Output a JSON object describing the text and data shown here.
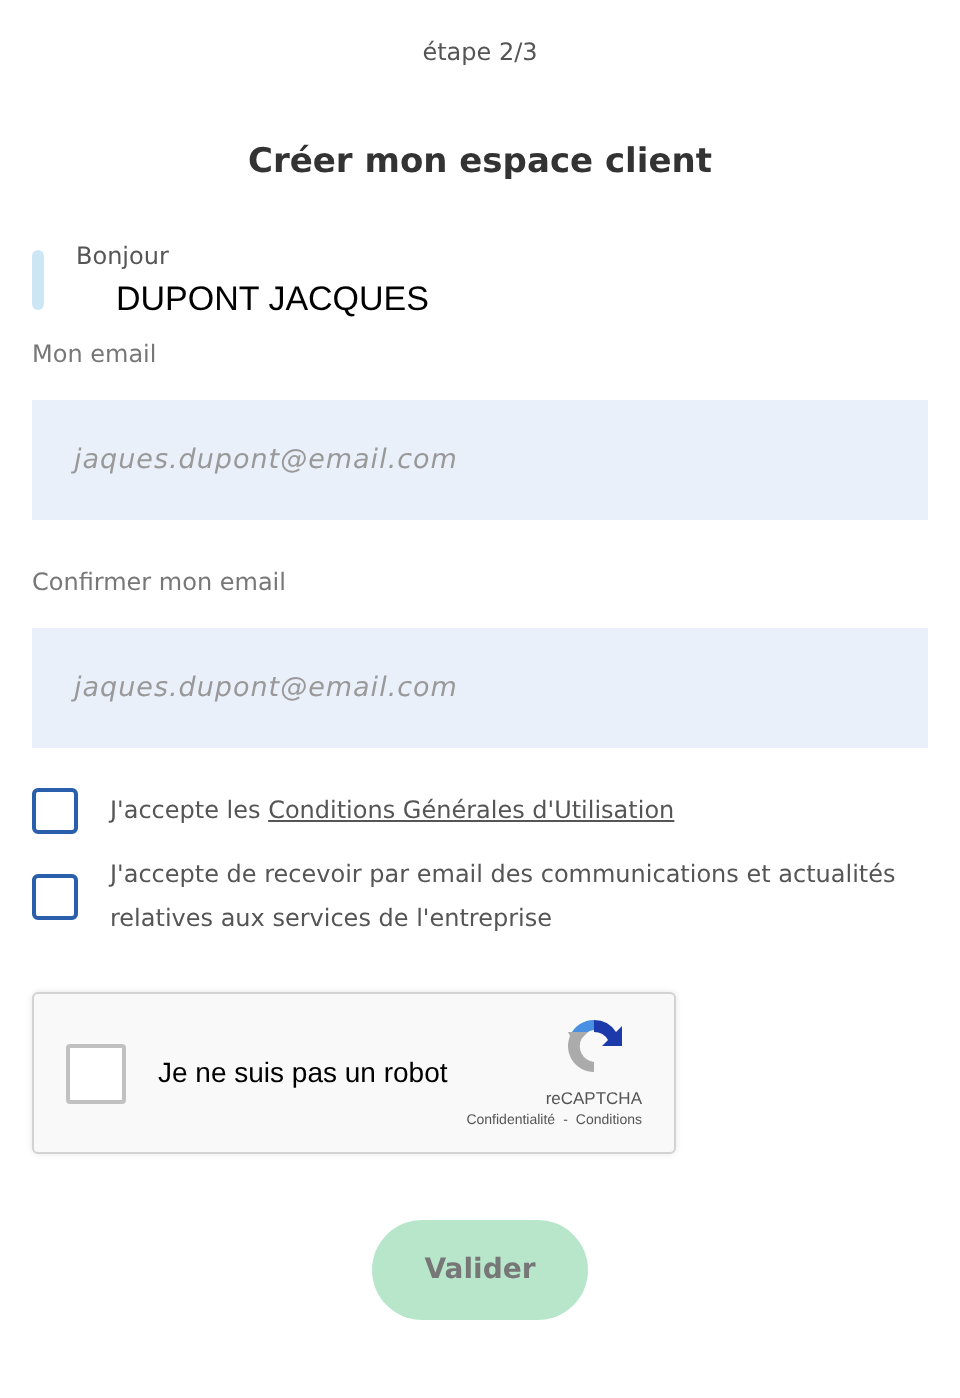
{
  "step": "étape 2/3",
  "title": "Créer mon espace client",
  "greeting": {
    "label": "Bonjour",
    "name": "DUPONT JACQUES"
  },
  "fields": [
    {
      "label": "Mon email",
      "placeholder": "jaques.dupont@email.com"
    },
    {
      "label": "Confirmer mon email",
      "placeholder": "jaques.dupont@email.com"
    }
  ],
  "consents": [
    {
      "text": "J'accepte les ",
      "link": "Conditions Générales d'Utilisation",
      "checked": false
    },
    {
      "text": "J'accepte de recevoir par email des communications et actualités relatives aux services de l'entreprise",
      "checked": false
    }
  ],
  "captcha": {
    "label": "Je ne suis pas un robot",
    "checked": false,
    "brand": "reCAPTCHA",
    "links": [
      "Confidentialité",
      "Conditions"
    ],
    "separator": "-"
  },
  "submit": {
    "label": "Valider",
    "disabled": true
  }
}
